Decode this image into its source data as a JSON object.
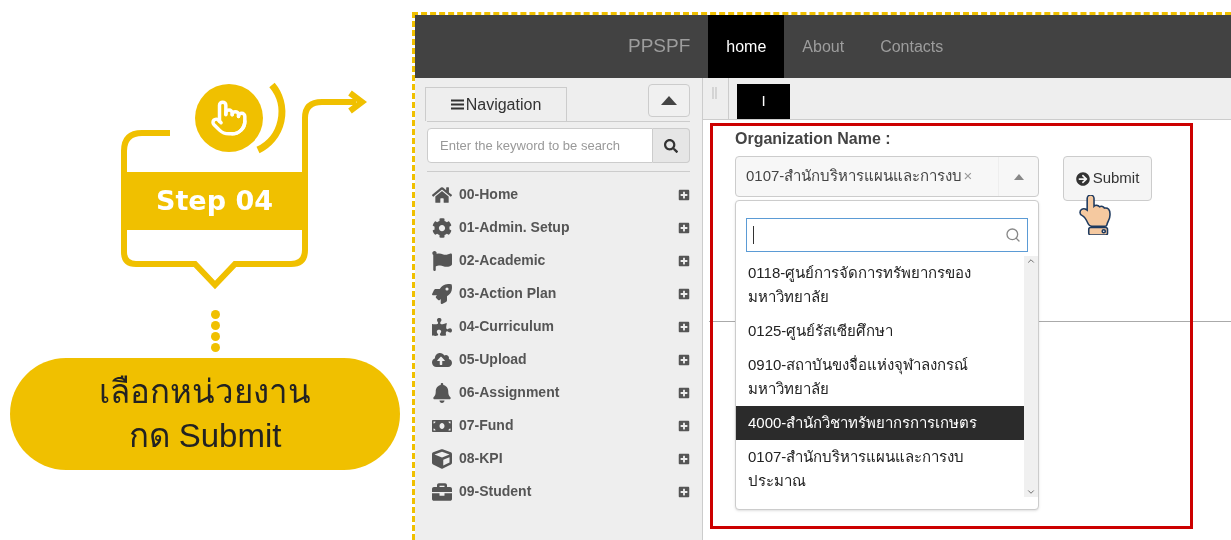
{
  "step": {
    "label": "Step 04",
    "instruction": [
      "เลือกหน่วยงาน",
      "กด Submit"
    ]
  },
  "navbar": {
    "brand": "PPSPF",
    "links": [
      {
        "label": "home",
        "selected": true
      },
      {
        "label": "About",
        "selected": false
      },
      {
        "label": "Contacts",
        "selected": false
      }
    ]
  },
  "sidebar": {
    "tab": "Navigation",
    "search": {
      "placeholder": "Enter the keyword to be search"
    },
    "items": [
      {
        "label": "00-Home"
      },
      {
        "label": "01-Admin. Setup"
      },
      {
        "label": "02-Academic"
      },
      {
        "label": "03-Action Plan"
      },
      {
        "label": "04-Curriculum"
      },
      {
        "label": "05-Upload"
      },
      {
        "label": "06-Assignment"
      },
      {
        "label": "07-Fund"
      },
      {
        "label": "08-KPI"
      },
      {
        "label": "09-Student"
      }
    ]
  },
  "content": {
    "tab": "I",
    "label": "Organization Name :",
    "select": {
      "value": "0107-สำนักบริหารแผนและการงบ",
      "clear": "×",
      "expanded": true
    },
    "options": [
      {
        "label": "0118-ศูนย์การจัดการทรัพยากรของมหาวิทยาลัย",
        "selected": false
      },
      {
        "label": "0125-ศูนย์รัสเซียศึกษา",
        "selected": false
      },
      {
        "label": "0910-สถาบันขงจื่อแห่งจุฬาลงกรณ์มหาวิทยาลัย",
        "selected": false
      },
      {
        "label": "4000-สำนักวิชาทรัพยากรการเกษตร",
        "selected": true
      },
      {
        "label": "0107-สำนักบริหารแผนและการงบประมาณ",
        "selected": false
      }
    ],
    "submit": "Submit"
  }
}
